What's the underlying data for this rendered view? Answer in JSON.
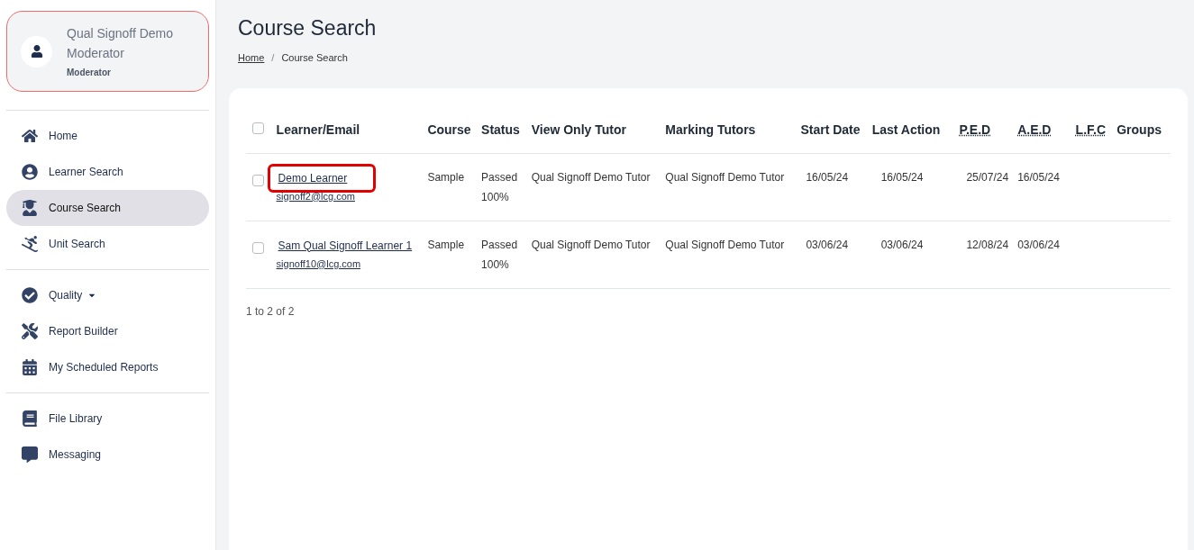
{
  "user": {
    "name": "Qual Signoff Demo Moderator",
    "role": "Moderator"
  },
  "sidebar": {
    "sections": [
      [
        {
          "label": "Home",
          "selected": false,
          "dropdown": false
        },
        {
          "label": "Learner Search",
          "selected": false,
          "dropdown": false
        },
        {
          "label": "Course Search",
          "selected": true,
          "dropdown": false
        },
        {
          "label": "Unit Search",
          "selected": false,
          "dropdown": false
        }
      ],
      [
        {
          "label": "Quality",
          "selected": false,
          "dropdown": true
        },
        {
          "label": "Report Builder",
          "selected": false,
          "dropdown": false
        },
        {
          "label": "My Scheduled Reports",
          "selected": false,
          "dropdown": false
        }
      ],
      [
        {
          "label": "File Library",
          "selected": false,
          "dropdown": false
        },
        {
          "label": "Messaging",
          "selected": false,
          "dropdown": false
        }
      ]
    ]
  },
  "page": {
    "title": "Course Search",
    "breadcrumb_separator": "/",
    "breadcrumb": [
      {
        "label": "Home",
        "link": true
      },
      {
        "label": "Course Search",
        "link": false
      }
    ]
  },
  "table": {
    "select_all_checked": false,
    "columns": [
      {
        "label": "Learner/Email",
        "abbr": false
      },
      {
        "label": "Course",
        "abbr": false
      },
      {
        "label": "Status",
        "abbr": false
      },
      {
        "label": "View Only Tutor",
        "abbr": false
      },
      {
        "label": "Marking Tutors",
        "abbr": false
      },
      {
        "label": "Start Date",
        "abbr": false
      },
      {
        "label": "Last Action",
        "abbr": false
      },
      {
        "label": "P.E.D",
        "abbr": true
      },
      {
        "label": "A.E.D",
        "abbr": true
      },
      {
        "label": "L.F.C",
        "abbr": true
      },
      {
        "label": "Groups",
        "abbr": false
      }
    ],
    "rows": [
      {
        "checked": false,
        "highlighted": true,
        "learner": "Demo Learner",
        "email": "signoff2@lcg.com",
        "course": "Sample",
        "status": "Passed",
        "percent": "100%",
        "view_only_tutor": "Qual Signoff Demo Tutor",
        "marking_tutors": "Qual Signoff Demo Tutor",
        "start_date": "16/05/24",
        "last_action": "16/05/24",
        "ped": "25/07/24",
        "aed": "16/05/24"
      },
      {
        "checked": false,
        "highlighted": false,
        "learner": "Sam Qual Signoff Learner 1",
        "email": "signoff10@lcg.com",
        "course": "Sample",
        "status": "Passed",
        "percent": "100%",
        "view_only_tutor": "Qual Signoff Demo Tutor",
        "marking_tutors": "Qual Signoff Demo Tutor",
        "start_date": "03/06/24",
        "last_action": "03/06/24",
        "ped": "12/08/24",
        "aed": "03/06/24"
      }
    ],
    "footer": "1 to 2 of 2"
  }
}
